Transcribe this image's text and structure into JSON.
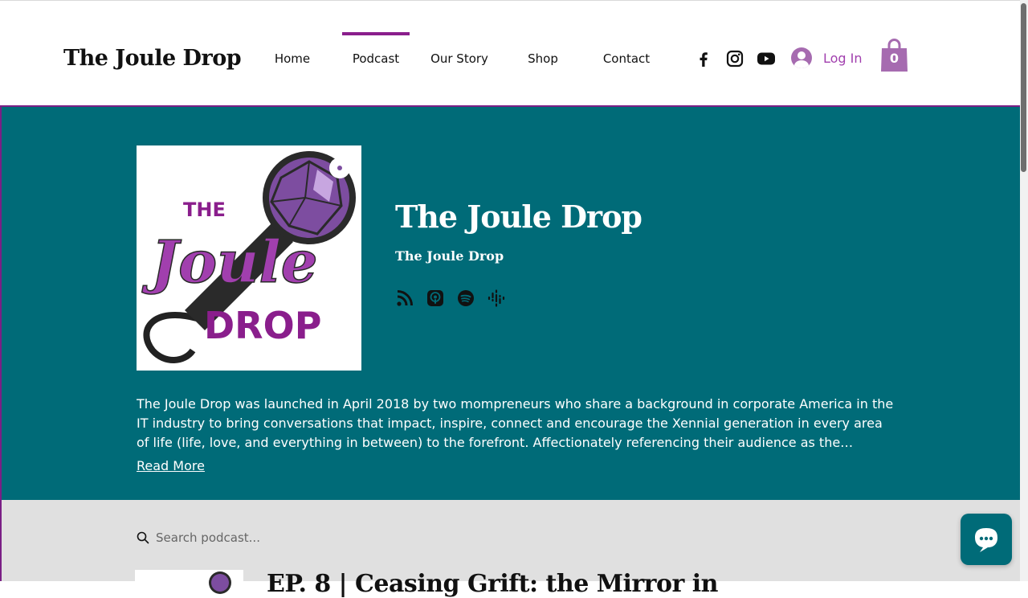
{
  "header": {
    "brand": "The Joule Drop",
    "nav": [
      "Home",
      "Podcast",
      "Our Story",
      "Shop",
      "Contact"
    ],
    "active_nav": "Podcast",
    "social": [
      "facebook-icon",
      "instagram-icon",
      "youtube-icon"
    ],
    "login_label": "Log In",
    "cart_count": "0"
  },
  "hero": {
    "cover": {
      "word_top": "THE",
      "word_script": "Joule",
      "word_bottom": "DROP"
    },
    "title": "The Joule Drop",
    "author": "The Joule Drop",
    "platforms": [
      "rss-icon",
      "apple-podcasts-icon",
      "spotify-icon",
      "google-podcasts-icon"
    ],
    "description": "The Joule Drop was launched in April 2018 by two mompreneurs who share a background in corporate America in the IT industry to bring conversations that impact, inspire, connect and encourage the Xennial generation in every area of life (life, love, and everything in between) to the forefront. Affectionately referencing their audience as the #JoulesandGem...",
    "read_more": "Read More"
  },
  "episodes": {
    "search_placeholder": "Search podcast...",
    "first_title": "EP. 8 | Ceasing Grift: the Mirror in"
  },
  "colors": {
    "teal": "#006b78",
    "purple": "#8a1e8c",
    "accent_purple": "#a13fae",
    "cart_purple": "#a66bb0"
  }
}
